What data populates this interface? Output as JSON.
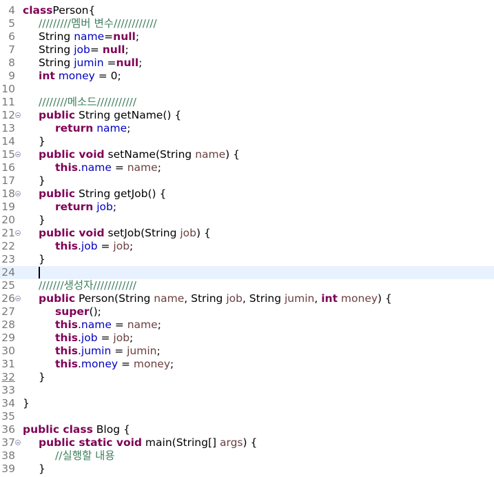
{
  "editor": {
    "lines": [
      {
        "n": "4",
        "indent": 0,
        "tokens": [
          [
            "kw",
            "class"
          ],
          [
            "",
            "Person{"
          ]
        ]
      },
      {
        "n": "5",
        "indent": 1,
        "tokens": [
          [
            "cmt",
            "/////////"
          ],
          [
            "cmt ko",
            "멤버 변수"
          ],
          [
            "cmt",
            "////////////"
          ]
        ]
      },
      {
        "n": "6",
        "indent": 1,
        "tokens": [
          [
            "",
            "String "
          ],
          [
            "fld",
            "name"
          ],
          [
            "",
            "="
          ],
          [
            "kw",
            "null"
          ],
          [
            "",
            ";"
          ]
        ]
      },
      {
        "n": "7",
        "indent": 1,
        "tokens": [
          [
            "",
            "String "
          ],
          [
            "fld",
            "job"
          ],
          [
            "",
            "= "
          ],
          [
            "kw",
            "null"
          ],
          [
            "",
            ";"
          ]
        ]
      },
      {
        "n": "8",
        "indent": 1,
        "tokens": [
          [
            "",
            "String "
          ],
          [
            "fld",
            "jumin"
          ],
          [
            "",
            " ="
          ],
          [
            "kw",
            "null"
          ],
          [
            "",
            ";"
          ]
        ]
      },
      {
        "n": "9",
        "indent": 1,
        "tokens": [
          [
            "kw",
            "int"
          ],
          [
            "",
            " "
          ],
          [
            "fld",
            "money"
          ],
          [
            "",
            " = 0;"
          ]
        ]
      },
      {
        "n": "10",
        "indent": 0,
        "tokens": []
      },
      {
        "n": "11",
        "indent": 1,
        "tokens": [
          [
            "cmt",
            "////////"
          ],
          [
            "cmt ko",
            "메소드"
          ],
          [
            "cmt",
            "///////////"
          ]
        ]
      },
      {
        "n": "12",
        "fold": true,
        "indent": 1,
        "tokens": [
          [
            "kw",
            "public"
          ],
          [
            "",
            " String getName() {"
          ]
        ]
      },
      {
        "n": "13",
        "indent": 2,
        "tokens": [
          [
            "kw",
            "return"
          ],
          [
            "",
            " "
          ],
          [
            "fld",
            "name"
          ],
          [
            "",
            ";"
          ]
        ]
      },
      {
        "n": "14",
        "indent": 1,
        "tokens": [
          [
            "",
            "}"
          ]
        ]
      },
      {
        "n": "15",
        "fold": true,
        "indent": 1,
        "tokens": [
          [
            "kw",
            "public void"
          ],
          [
            "",
            " setName(String "
          ],
          [
            "prm",
            "name"
          ],
          [
            "",
            ") {"
          ]
        ]
      },
      {
        "n": "16",
        "indent": 2,
        "tokens": [
          [
            "kw",
            "this"
          ],
          [
            "",
            "."
          ],
          [
            "fld",
            "name"
          ],
          [
            "",
            " = "
          ],
          [
            "prm",
            "name"
          ],
          [
            "",
            ";"
          ]
        ]
      },
      {
        "n": "17",
        "indent": 1,
        "tokens": [
          [
            "",
            "}"
          ]
        ]
      },
      {
        "n": "18",
        "fold": true,
        "indent": 1,
        "tokens": [
          [
            "kw",
            "public"
          ],
          [
            "",
            " String getJob() {"
          ]
        ]
      },
      {
        "n": "19",
        "indent": 2,
        "tokens": [
          [
            "kw",
            "return"
          ],
          [
            "",
            " "
          ],
          [
            "fld",
            "job"
          ],
          [
            "",
            ";"
          ]
        ]
      },
      {
        "n": "20",
        "indent": 1,
        "tokens": [
          [
            "",
            "}"
          ]
        ]
      },
      {
        "n": "21",
        "fold": true,
        "indent": 1,
        "tokens": [
          [
            "kw",
            "public void"
          ],
          [
            "",
            " setJob(String "
          ],
          [
            "prm",
            "job"
          ],
          [
            "",
            ") {"
          ]
        ]
      },
      {
        "n": "22",
        "indent": 2,
        "tokens": [
          [
            "kw",
            "this"
          ],
          [
            "",
            "."
          ],
          [
            "fld",
            "job"
          ],
          [
            "",
            " = "
          ],
          [
            "prm",
            "job"
          ],
          [
            "",
            ";"
          ]
        ]
      },
      {
        "n": "23",
        "indent": 1,
        "tokens": [
          [
            "",
            "}"
          ]
        ]
      },
      {
        "n": "24",
        "indent": 1,
        "current": true,
        "caret": true,
        "tokens": []
      },
      {
        "n": "25",
        "indent": 1,
        "tokens": [
          [
            "cmt",
            "///////"
          ],
          [
            "cmt ko",
            "생성자"
          ],
          [
            "cmt",
            "////////////"
          ]
        ]
      },
      {
        "n": "26",
        "fold": true,
        "indent": 1,
        "tokens": [
          [
            "kw",
            "public"
          ],
          [
            "",
            " Person(String "
          ],
          [
            "prm",
            "name"
          ],
          [
            "",
            ", String "
          ],
          [
            "prm",
            "job"
          ],
          [
            "",
            ", String "
          ],
          [
            "prm",
            "jumin"
          ],
          [
            "",
            ", "
          ],
          [
            "kw",
            "int"
          ],
          [
            "",
            " "
          ],
          [
            "prm",
            "money"
          ],
          [
            "",
            ") {"
          ]
        ]
      },
      {
        "n": "27",
        "indent": 2,
        "tokens": [
          [
            "kw",
            "super"
          ],
          [
            "",
            "();"
          ]
        ]
      },
      {
        "n": "28",
        "indent": 2,
        "tokens": [
          [
            "kw",
            "this"
          ],
          [
            "",
            "."
          ],
          [
            "fld",
            "name"
          ],
          [
            "",
            " = "
          ],
          [
            "prm",
            "name"
          ],
          [
            "",
            ";"
          ]
        ]
      },
      {
        "n": "29",
        "indent": 2,
        "tokens": [
          [
            "kw",
            "this"
          ],
          [
            "",
            "."
          ],
          [
            "fld",
            "job"
          ],
          [
            "",
            " = "
          ],
          [
            "prm",
            "job"
          ],
          [
            "",
            ";"
          ]
        ]
      },
      {
        "n": "30",
        "indent": 2,
        "tokens": [
          [
            "kw",
            "this"
          ],
          [
            "",
            "."
          ],
          [
            "fld",
            "jumin"
          ],
          [
            "",
            " = "
          ],
          [
            "prm",
            "jumin"
          ],
          [
            "",
            ";"
          ]
        ]
      },
      {
        "n": "31",
        "indent": 2,
        "tokens": [
          [
            "kw",
            "this"
          ],
          [
            "",
            "."
          ],
          [
            "fld",
            "money"
          ],
          [
            "",
            " = "
          ],
          [
            "prm",
            "money"
          ],
          [
            "",
            ";"
          ]
        ]
      },
      {
        "n": "32",
        "underline": true,
        "indent": 1,
        "tokens": [
          [
            "",
            "}"
          ]
        ]
      },
      {
        "n": "33",
        "indent": 0,
        "tokens": []
      },
      {
        "n": "34",
        "indent": 0,
        "tokens": [
          [
            "",
            "}"
          ]
        ]
      },
      {
        "n": "35",
        "indent": 0,
        "tokens": []
      },
      {
        "n": "36",
        "indent": 0,
        "tokens": [
          [
            "kw",
            "public class"
          ],
          [
            "",
            " Blog {"
          ]
        ]
      },
      {
        "n": "37",
        "fold": true,
        "indent": 1,
        "tokens": [
          [
            "kw",
            "public static void"
          ],
          [
            "",
            " main(String[] "
          ],
          [
            "prm",
            "args"
          ],
          [
            "",
            ") {"
          ]
        ]
      },
      {
        "n": "38",
        "indent": 2,
        "tokens": [
          [
            "cmt",
            "//"
          ],
          [
            "cmt ko",
            "실행할 내용"
          ]
        ]
      },
      {
        "n": "39",
        "indent": 1,
        "tokens": [
          [
            "",
            "}"
          ]
        ]
      }
    ]
  },
  "colors": {
    "keyword": "#7f0055",
    "field": "#0000c0",
    "parameter": "#6a3e3e",
    "comment": "#3f7f5f",
    "line_number": "#787878",
    "current_line": "#e8f2fe"
  }
}
